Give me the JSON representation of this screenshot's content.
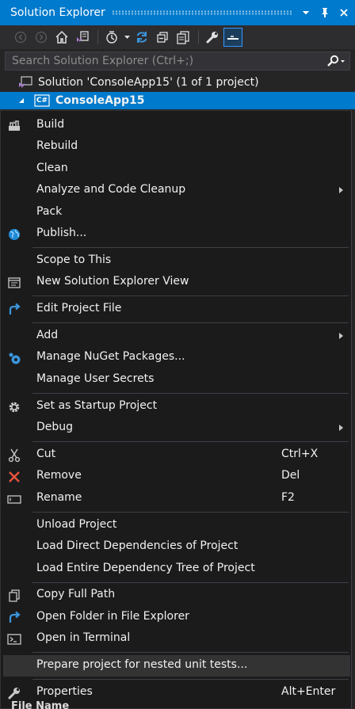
{
  "window": {
    "title": "Solution Explorer",
    "colors": {
      "accent": "#007acc",
      "menu_bg": "#1b1b1c",
      "panel_bg": "#252526"
    }
  },
  "toolbar": {
    "icons": [
      "back-icon",
      "forward-icon",
      "home-icon",
      "switch-views-icon",
      "pending-changes-icon",
      "sync-icon",
      "collapse-all-icon",
      "show-all-files-icon",
      "properties-icon",
      "preview-selected-icon"
    ]
  },
  "search": {
    "placeholder": "Search Solution Explorer (Ctrl+;)"
  },
  "tree": {
    "solution": "Solution 'ConsoleApp15' (1 of 1 project)",
    "project": "ConsoleApp15",
    "project_badge": "C#"
  },
  "menu": {
    "items": [
      {
        "label": "Build",
        "icon": "build-icon"
      },
      {
        "label": "Rebuild"
      },
      {
        "label": "Clean"
      },
      {
        "label": "Analyze and Code Cleanup",
        "submenu": true
      },
      {
        "label": "Pack"
      },
      {
        "label": "Publish...",
        "icon": "globe-icon"
      },
      {
        "label": "Scope to This"
      },
      {
        "label": "New Solution Explorer View",
        "icon": "new-view-icon"
      },
      {
        "label": "Edit Project File",
        "icon": "edit-arrow-icon"
      },
      {
        "label": "Add",
        "submenu": true
      },
      {
        "label": "Manage NuGet Packages...",
        "icon": "nuget-icon"
      },
      {
        "label": "Manage User Secrets"
      },
      {
        "label": "Set as Startup Project",
        "icon": "gear-icon"
      },
      {
        "label": "Debug",
        "submenu": true
      },
      {
        "label": "Cut",
        "shortcut": "Ctrl+X",
        "icon": "scissors-icon"
      },
      {
        "label": "Remove",
        "shortcut": "Del",
        "icon": "remove-x-icon"
      },
      {
        "label": "Rename",
        "shortcut": "F2",
        "icon": "rename-icon"
      },
      {
        "label": "Unload Project"
      },
      {
        "label": "Load Direct Dependencies of Project"
      },
      {
        "label": "Load Entire Dependency Tree of Project"
      },
      {
        "label": "Copy Full Path",
        "icon": "copy-icon"
      },
      {
        "label": "Open Folder in File Explorer",
        "icon": "open-folder-arrow-icon"
      },
      {
        "label": "Open in Terminal",
        "icon": "terminal-icon"
      },
      {
        "label": "Prepare project for nested unit tests...",
        "highlighted": true
      },
      {
        "label": "Properties",
        "shortcut": "Alt+Enter",
        "icon": "wrench-icon"
      }
    ]
  },
  "partial_label": "File Name"
}
